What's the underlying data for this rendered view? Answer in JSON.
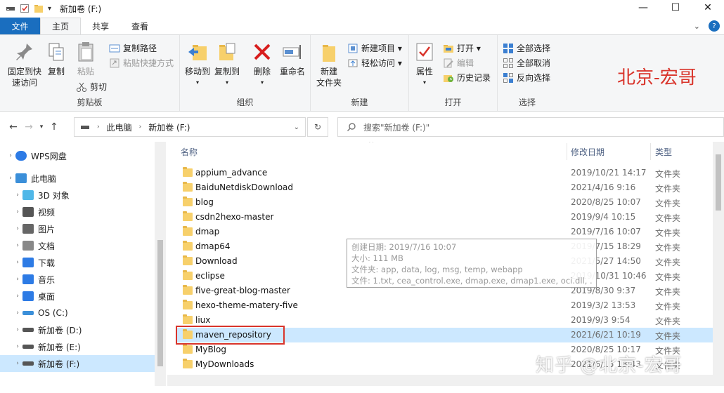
{
  "window": {
    "title": "新加卷 (F:)",
    "minimize_glyph": "—",
    "maximize_glyph": "☐",
    "close_glyph": "✕"
  },
  "ribbon_tabs": [
    "文件",
    "主页",
    "共享",
    "查看"
  ],
  "ribbon": {
    "groups": {
      "clipboard": "剪贴板",
      "organize": "组织",
      "new": "新建",
      "open": "打开",
      "select": "选择"
    },
    "pin_quick_access": "固定到快\n速访问",
    "copy": "复制",
    "paste": "粘贴",
    "copy_path": "复制路径",
    "paste_shortcut": "粘贴快捷方式",
    "cut": "剪切",
    "move_to": "移动到",
    "copy_to": "复制到",
    "delete": "删除",
    "rename": "重命名",
    "new_folder": "新建\n文件夹",
    "new_item": "新建项目 ▾",
    "easy_access": "轻松访问 ▾",
    "properties": "属性",
    "open": "打开 ▾",
    "edit": "编辑",
    "history": "历史记录",
    "select_all": "全部选择",
    "select_none": "全部取消",
    "invert_selection": "反向选择"
  },
  "brand_text": "北京-宏哥",
  "address": {
    "segments": [
      "此电脑",
      "新加卷 (F:)"
    ],
    "search_placeholder": "搜索\"新加卷 (F:)\""
  },
  "nav_pane": [
    {
      "label": "WPS网盘",
      "icon": "cloud-icon",
      "indent": 1,
      "selected": false
    },
    {
      "label": "此电脑",
      "icon": "computer-icon",
      "indent": 1,
      "selected": false
    },
    {
      "label": "3D 对象",
      "icon": "cube-icon",
      "indent": 2,
      "selected": false
    },
    {
      "label": "视频",
      "icon": "video-icon",
      "indent": 2,
      "selected": false
    },
    {
      "label": "图片",
      "icon": "picture-icon",
      "indent": 2,
      "selected": false
    },
    {
      "label": "文档",
      "icon": "document-icon",
      "indent": 2,
      "selected": false
    },
    {
      "label": "下载",
      "icon": "download-icon",
      "indent": 2,
      "selected": false
    },
    {
      "label": "音乐",
      "icon": "music-icon",
      "indent": 2,
      "selected": false
    },
    {
      "label": "桌面",
      "icon": "desktop-icon",
      "indent": 2,
      "selected": false
    },
    {
      "label": "OS (C:)",
      "icon": "os-drive-icon",
      "indent": 2,
      "selected": false
    },
    {
      "label": "新加卷 (D:)",
      "icon": "drive-icon",
      "indent": 2,
      "selected": false
    },
    {
      "label": "新加卷 (E:)",
      "icon": "drive-icon",
      "indent": 2,
      "selected": false
    },
    {
      "label": "新加卷 (F:)",
      "icon": "drive-icon",
      "indent": 2,
      "selected": true
    }
  ],
  "columns": {
    "name": "名称",
    "date": "修改日期",
    "type": "类型"
  },
  "files": [
    {
      "name": "appium_advance",
      "date": "2019/10/21 14:17",
      "type": "文件夹"
    },
    {
      "name": "BaiduNetdiskDownload",
      "date": "2021/4/16 9:16",
      "type": "文件夹"
    },
    {
      "name": "blog",
      "date": "2020/8/25 10:07",
      "type": "文件夹"
    },
    {
      "name": "csdn2hexo-master",
      "date": "2019/9/4 10:15",
      "type": "文件夹"
    },
    {
      "name": "dmap",
      "date": "2019/7/16 10:07",
      "type": "文件夹"
    },
    {
      "name": "dmap64",
      "date": "2019/7/15 18:29",
      "type": "文件夹"
    },
    {
      "name": "Download",
      "date": "2021/5/27 14:50",
      "type": "文件夹"
    },
    {
      "name": "eclipse",
      "date": "2019/10/31 10:46",
      "type": "文件夹"
    },
    {
      "name": "five-great-blog-master",
      "date": "2019/8/30 9:37",
      "type": "文件夹"
    },
    {
      "name": "hexo-theme-matery-five",
      "date": "2019/3/2 13:53",
      "type": "文件夹"
    },
    {
      "name": "liux",
      "date": "2019/9/3 9:54",
      "type": "文件夹"
    },
    {
      "name": "maven_repository",
      "date": "2021/6/21 10:19",
      "type": "文件夹"
    },
    {
      "name": "MyBlog",
      "date": "2020/8/25 10:17",
      "type": "文件夹"
    },
    {
      "name": "MyDownloads",
      "date": "2021/6/15 13:43",
      "type": "文件夹"
    }
  ],
  "selected_file_index": 11,
  "tooltip": {
    "line1": "创建日期: 2019/7/16 10:07",
    "line2": "大小: 111 MB",
    "line3": "文件夹: app, data, log, msg, temp, webapp",
    "line4": "文件: 1.txt, cea_control.exe, dmap.exe, dmap1.exe, oci.dll, ..."
  },
  "watermark": "知乎 @北京-宏哥",
  "colors": {
    "accent": "#1a6ebf",
    "selection": "#cce8ff",
    "highlight": "#d9342b"
  }
}
